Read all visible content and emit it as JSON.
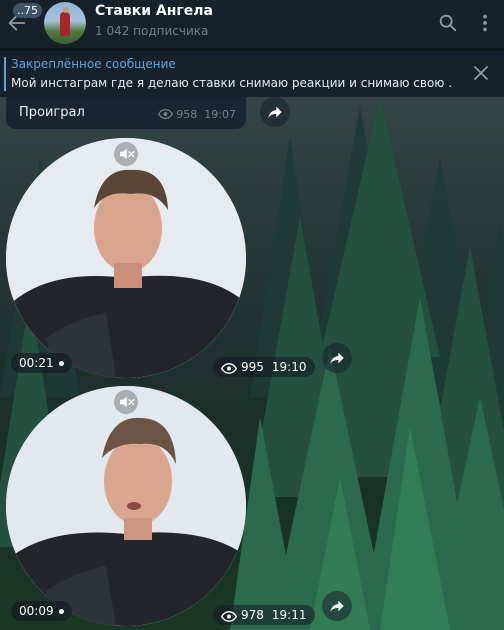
{
  "header": {
    "unread_badge": "..75",
    "title": "Ставки Ангела",
    "subscribers": "1 042 подписчика"
  },
  "pinned": {
    "title": "Закреплённое сообщение",
    "text": "Мой инстаграм где я делаю ставки снимаю реакции и снимаю свою ..."
  },
  "messages": [
    {
      "type": "text",
      "text": "Проиграл",
      "views": "958",
      "time": "19:07"
    },
    {
      "type": "video_note",
      "duration": "00:21",
      "views": "995",
      "time": "19:10"
    },
    {
      "type": "video_note",
      "duration": "00:09",
      "views": "978",
      "time": "19:11"
    }
  ],
  "icons": [
    "back-arrow-icon",
    "search-icon",
    "more-vertical-icon",
    "close-icon",
    "share-icon",
    "mute-icon",
    "eye-icon"
  ],
  "colors": {
    "header_bg": "#17212b",
    "accent": "#5ea3df",
    "muted_text": "#6d7f8f"
  }
}
